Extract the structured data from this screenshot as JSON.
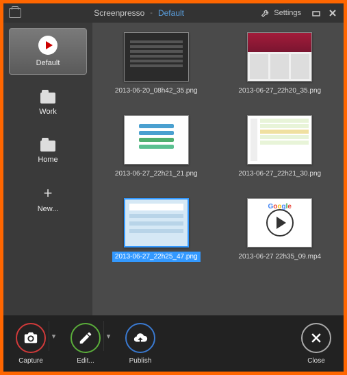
{
  "titlebar": {
    "app": "Screenpresso",
    "dash": "-",
    "workspace": "Default",
    "settings_label": "Settings"
  },
  "sidebar": {
    "items": [
      {
        "label": "Default"
      },
      {
        "label": "Work"
      },
      {
        "label": "Home"
      },
      {
        "label": "New..."
      }
    ]
  },
  "thumbnails": [
    {
      "label": "2013-06-20_08h42_35.png",
      "selected": false
    },
    {
      "label": "2013-06-27_22h20_35.png",
      "selected": false
    },
    {
      "label": "2013-06-27_22h21_21.png",
      "selected": false
    },
    {
      "label": "2013-06-27_22h21_30.png",
      "selected": false
    },
    {
      "label": "2013-06-27_22h25_47.png",
      "selected": true
    },
    {
      "label": "2013-06-27 22h35_09.mp4",
      "selected": false
    }
  ],
  "toolbar": {
    "capture_label": "Capture",
    "edit_label": "Edit...",
    "publish_label": "Publish",
    "close_label": "Close"
  },
  "colors": {
    "capture": "#d23a3a",
    "edit": "#5aad3a",
    "publish": "#3a7ad2",
    "close": "#aaaaaa"
  }
}
